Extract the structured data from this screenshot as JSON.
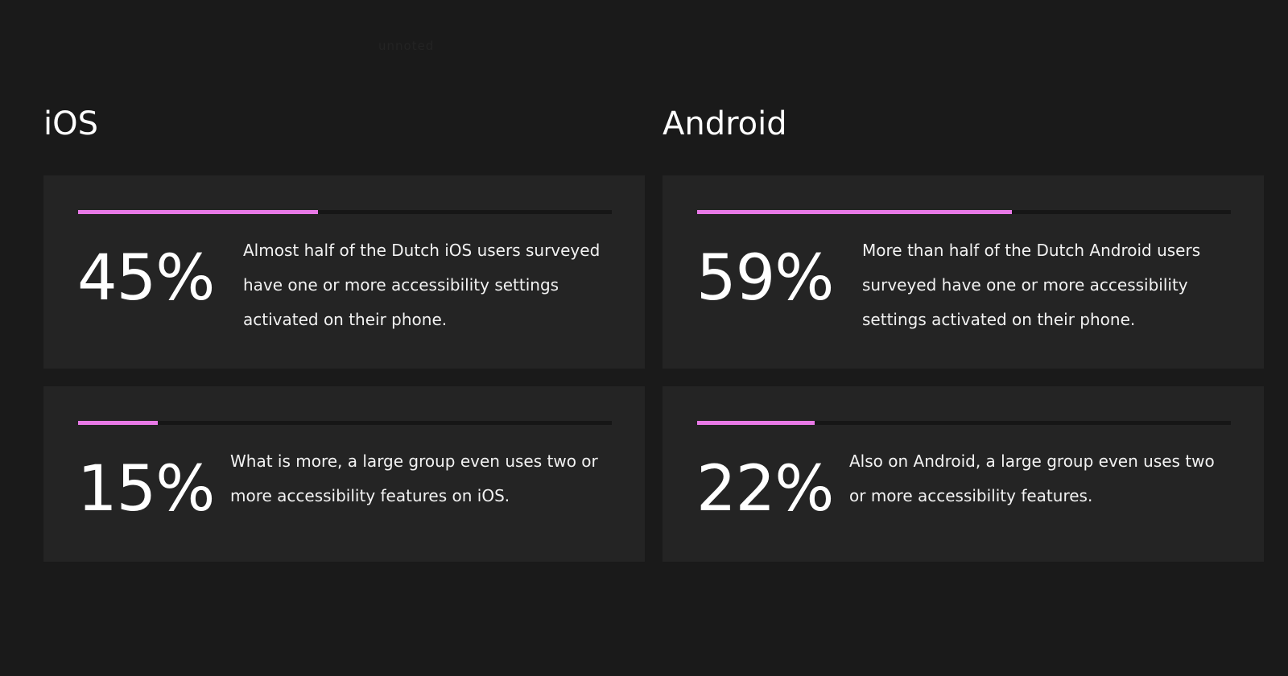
{
  "accent_color": "#e879e6",
  "header": {
    "ghost_text": "unnoted"
  },
  "platforms": [
    {
      "title": "iOS",
      "stats": [
        {
          "value": "45%",
          "fraction": 0.45,
          "text": "Almost half of the Dutch iOS users surveyed have one or more accessibility settings activated on their phone."
        },
        {
          "value": "15%",
          "fraction": 0.15,
          "text": "What is more, a large group even uses two or more accessibility features on iOS."
        }
      ]
    },
    {
      "title": "Android",
      "stats": [
        {
          "value": "59%",
          "fraction": 0.59,
          "text": "More than half of the Dutch Android users surveyed have one or more accessibility settings activated on their phone."
        },
        {
          "value": "22%",
          "fraction": 0.22,
          "text": "Also on Android, a large group even uses two or more accessibility features."
        }
      ]
    }
  ]
}
